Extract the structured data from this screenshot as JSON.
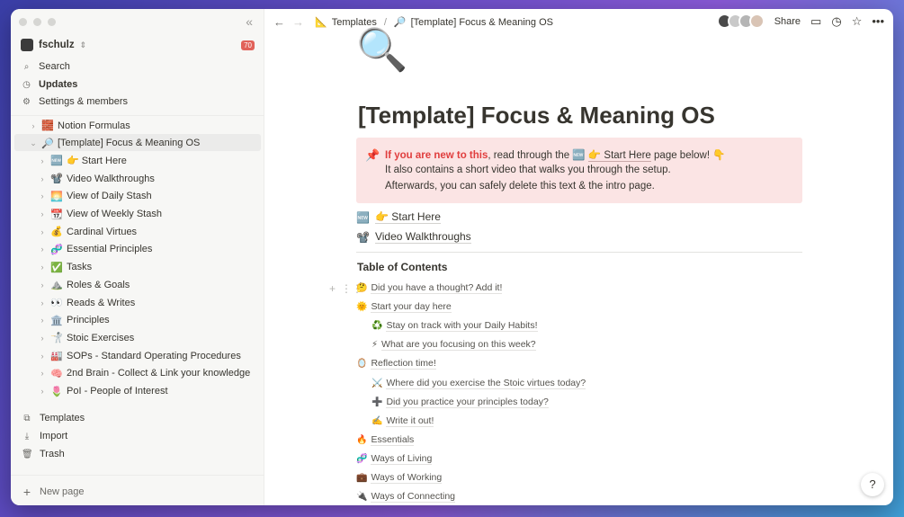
{
  "sidebar": {
    "workspace_name": "fschulz",
    "workspace_chevron": "⇕",
    "notification_count": "70",
    "collapse_icon": "«",
    "nav": [
      {
        "label": "Search",
        "icon": "search-icon"
      },
      {
        "label": "Updates",
        "icon": "clock-icon"
      },
      {
        "label": "Settings & members",
        "icon": "gear-icon"
      }
    ],
    "tree": [
      {
        "label": "Notion Formulas",
        "emoji": "🧱",
        "level": 0,
        "expanded": false
      },
      {
        "label": "[Template] Focus & Meaning OS",
        "emoji": "🔎",
        "level": 0,
        "expanded": true,
        "active": true
      },
      {
        "label": "👉 Start Here",
        "emoji": "🆕",
        "level": 1
      },
      {
        "label": "Video Walkthroughs",
        "emoji": "📽️",
        "level": 1
      },
      {
        "label": "View of Daily Stash",
        "emoji": "🌅",
        "level": 1
      },
      {
        "label": "View of Weekly Stash",
        "emoji": "📆",
        "level": 1
      },
      {
        "label": "Cardinal Virtues",
        "emoji": "💰",
        "level": 1
      },
      {
        "label": "Essential Principles",
        "emoji": "🧬",
        "level": 1
      },
      {
        "label": "Tasks",
        "emoji": "✅",
        "level": 1
      },
      {
        "label": "Roles & Goals",
        "emoji": "⛰️",
        "level": 1
      },
      {
        "label": "Reads & Writes",
        "emoji": "👀",
        "level": 1
      },
      {
        "label": "Principles",
        "emoji": "🏛️",
        "level": 1
      },
      {
        "label": "Stoic Exercises",
        "emoji": "🤺",
        "level": 1
      },
      {
        "label": "SOPs - Standard Operating Procedures",
        "emoji": "🏭",
        "level": 1
      },
      {
        "label": "2nd Brain - Collect & Link your knowledge",
        "emoji": "🧠",
        "level": 1
      },
      {
        "label": "PoI - People of Interest",
        "emoji": "🌷",
        "level": 1
      }
    ],
    "bottom": [
      {
        "label": "Templates",
        "icon": "templates-icon"
      },
      {
        "label": "Import",
        "icon": "import-icon"
      },
      {
        "label": "Trash",
        "icon": "trash-icon"
      }
    ],
    "new_page": "New page"
  },
  "topbar": {
    "breadcrumb": [
      {
        "label": "Templates",
        "emoji": "📐"
      },
      {
        "label": "[Template] Focus & Meaning OS",
        "emoji": "🔎"
      }
    ],
    "separator": "/",
    "share": "Share"
  },
  "page": {
    "icon": "🔍",
    "title": "[Template] Focus & Meaning OS",
    "callout": {
      "pin": "📌",
      "line1_red": "If you are new to this",
      "line1_mid": ", read through the ",
      "line1_link_emoji": "🆕",
      "line1_link": "👉 Start Here",
      "line1_end": " page below! 👇",
      "line2": "It also contains a short video that walks you through the setup.",
      "line3": "Afterwards, you can safely delete this text & the intro page."
    },
    "links": [
      {
        "emoji": "🆕",
        "label": "👉 Start Here"
      },
      {
        "emoji": "📽️",
        "label": "Video Walkthroughs"
      }
    ],
    "toc_title": "Table of Contents",
    "toc": [
      {
        "emoji": "🤔",
        "label": "Did you have a thought? Add it!",
        "indent": 0
      },
      {
        "emoji": "🌞",
        "label": "Start your day here",
        "indent": 0
      },
      {
        "emoji": "♻️",
        "label": "Stay on track with your Daily Habits!",
        "indent": 1
      },
      {
        "emoji": "⚡",
        "label": "What are you focusing on this week?",
        "indent": 1
      },
      {
        "emoji": "🪞",
        "label": "Reflection time!",
        "indent": 0
      },
      {
        "emoji": "⚔️",
        "label": "Where did you exercise the Stoic virtues today?",
        "indent": 1
      },
      {
        "emoji": "➕",
        "label": "Did you practice your principles today?",
        "indent": 1
      },
      {
        "emoji": "✍️",
        "label": "Write it out!",
        "indent": 1
      },
      {
        "emoji": "🔥",
        "label": "Essentials",
        "indent": 0
      },
      {
        "emoji": "🧬",
        "label": "Ways of Living",
        "indent": 0
      },
      {
        "emoji": "💼",
        "label": "Ways of Working",
        "indent": 0
      },
      {
        "emoji": "🔌",
        "label": "Ways of Connecting",
        "indent": 0
      }
    ]
  },
  "help": "?"
}
